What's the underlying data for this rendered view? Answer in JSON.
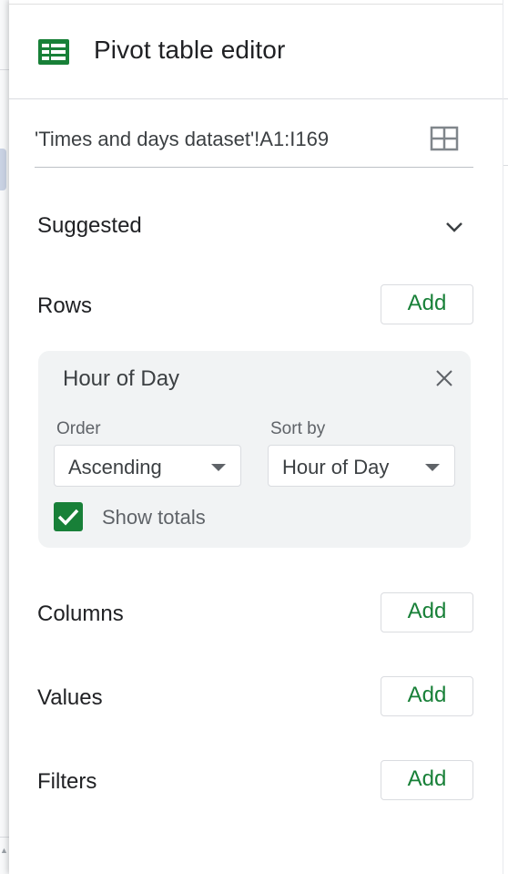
{
  "panel": {
    "title": "Pivot table editor",
    "range": "'Times and days dataset'!A1:I169"
  },
  "suggested": {
    "label": "Suggested"
  },
  "rows": {
    "label": "Rows",
    "add_label": "Add",
    "card": {
      "title": "Hour of Day",
      "order_label": "Order",
      "order_value": "Ascending",
      "sortby_label": "Sort by",
      "sortby_value": "Hour of Day",
      "show_totals_label": "Show totals",
      "show_totals_checked": true
    }
  },
  "columns": {
    "label": "Columns",
    "add_label": "Add"
  },
  "values": {
    "label": "Values",
    "add_label": "Add"
  },
  "filters": {
    "label": "Filters",
    "add_label": "Add"
  },
  "colors": {
    "accent_green": "#188038",
    "card_bg": "#f1f3f4",
    "sheets_icon_green": "#34a853"
  },
  "icons": {
    "header": "google-sheets-icon",
    "range_select": "grid-select-icon",
    "suggested_toggle": "chevron-down-icon",
    "card_close": "close-icon",
    "checkbox": "checkmark-icon"
  }
}
